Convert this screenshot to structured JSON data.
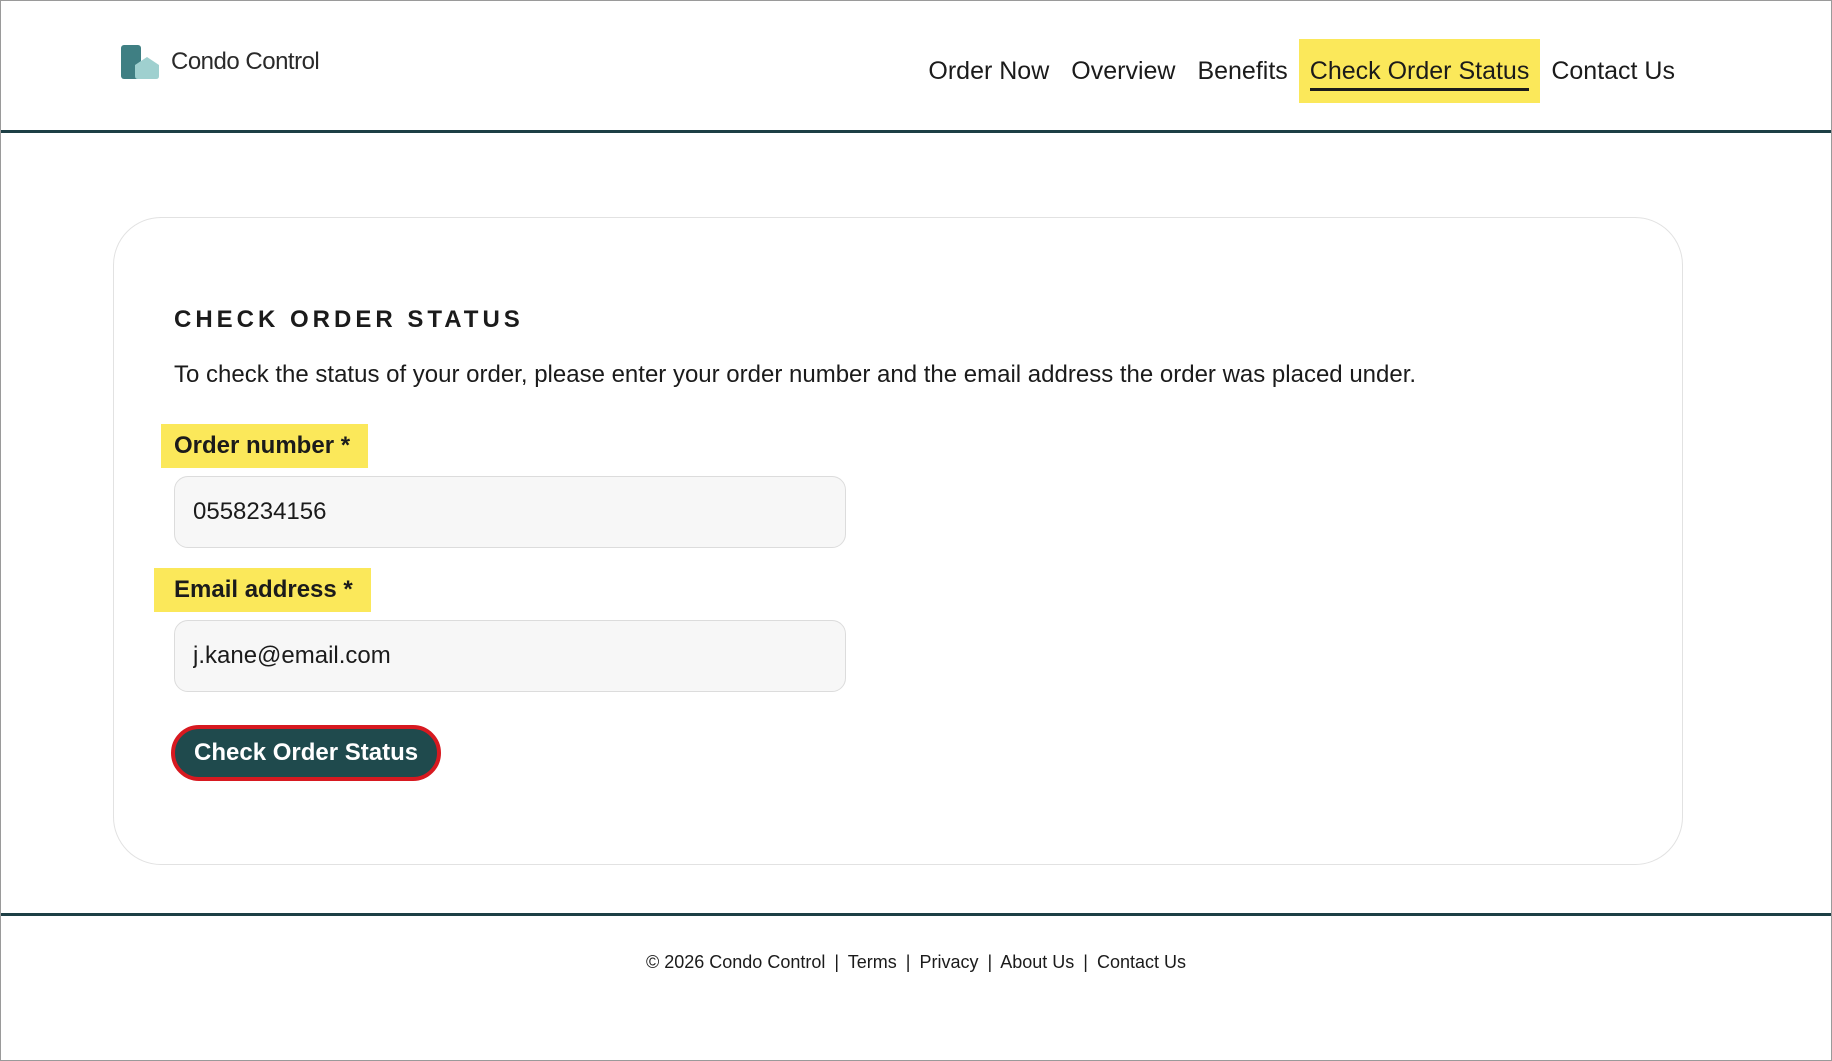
{
  "brand": {
    "name": "Condo Control",
    "logo_icon": "condo-building-icon",
    "colors": {
      "primary": "#1f4a4d",
      "highlight": "#fbe85a",
      "focus_ring": "#d71920"
    }
  },
  "nav": {
    "items": [
      {
        "label": "Order Now"
      },
      {
        "label": "Overview"
      },
      {
        "label": "Benefits"
      },
      {
        "label": "Check Order Status",
        "active": true
      },
      {
        "label": "Contact Us"
      }
    ]
  },
  "form": {
    "title": "CHECK ORDER STATUS",
    "description": "To check the status of your order, please enter your order number and the email address the order was placed under.",
    "order_number": {
      "label": "Order number *",
      "value": "0558234156"
    },
    "email": {
      "label": "Email address *",
      "value": "j.kane@email.com"
    },
    "submit_label": "Check Order Status"
  },
  "footer": {
    "copyright": "© 2026 Condo Control",
    "links": [
      {
        "label": "Terms"
      },
      {
        "label": "Privacy"
      },
      {
        "label": "About Us"
      },
      {
        "label": "Contact Us"
      }
    ],
    "separator": "|"
  }
}
